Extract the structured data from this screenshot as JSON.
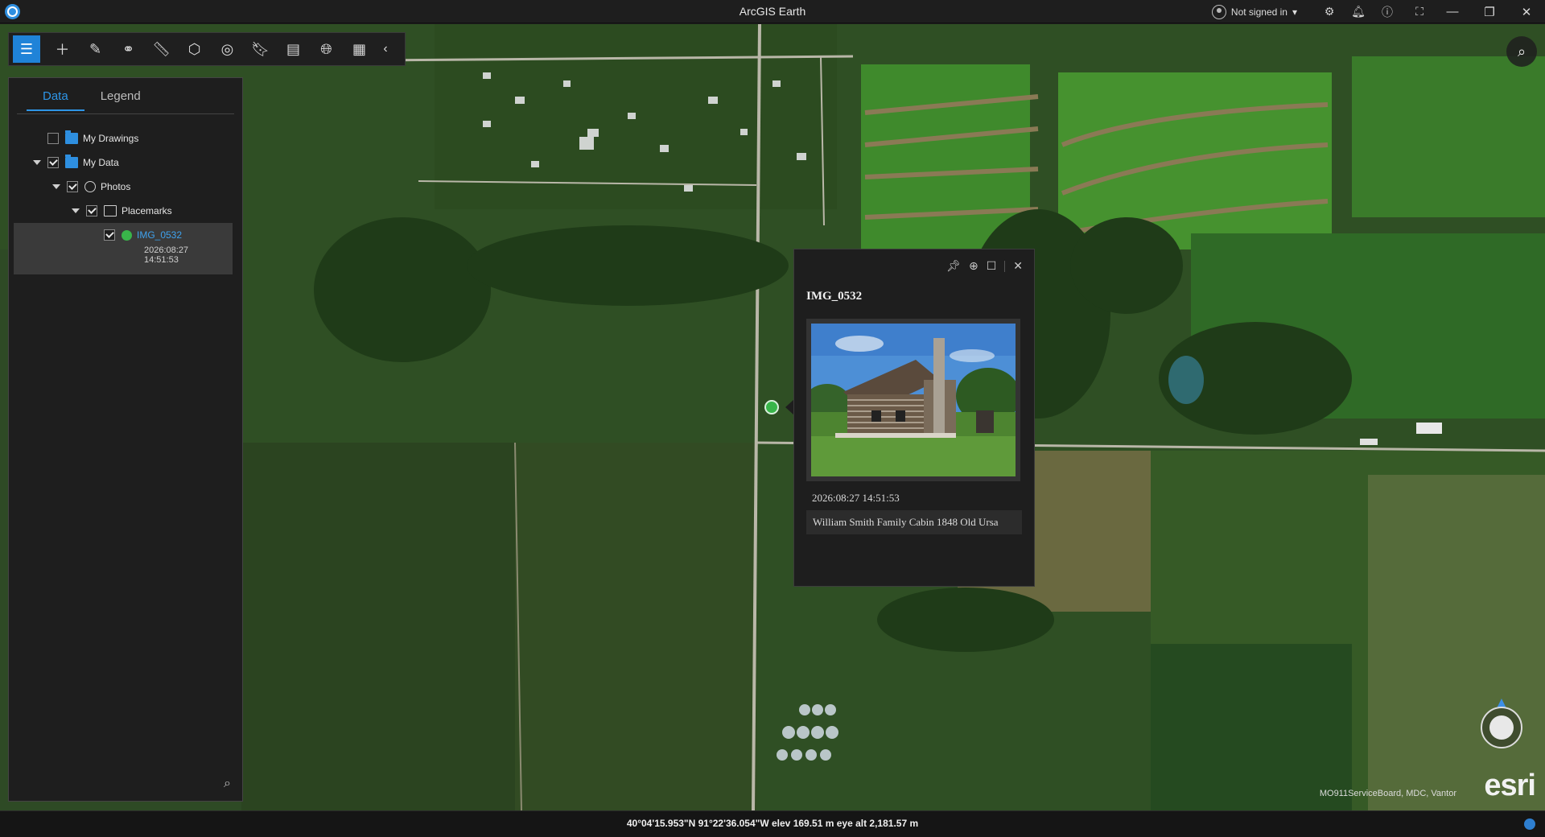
{
  "window": {
    "title": "ArcGIS Earth",
    "user": "Not signed in",
    "user_caret": "▾"
  },
  "icons": {
    "settings": "gear-icon",
    "notifications": "bell-icon",
    "about": "info-icon",
    "fullscreen": "fullscreen-icon",
    "minimize": "minimize-icon",
    "restore": "restore-icon",
    "close": "close-icon"
  },
  "toolbar": {
    "tools": [
      "layers",
      "add",
      "draw",
      "measure-link",
      "measure",
      "3d",
      "overlay",
      "bookmark",
      "presentation",
      "globe",
      "grid"
    ]
  },
  "panel": {
    "tabs": [
      "Data",
      "Legend"
    ],
    "tree": {
      "my_drawings": "My Drawings",
      "my_data": "My Data",
      "photos": "Photos",
      "placemarks": "Placemarks",
      "photo_name": "IMG_0532",
      "photo_date": "2026:08:27",
      "photo_time": "14:51:53"
    }
  },
  "popup": {
    "title": "IMG_0532",
    "timestamp": "2026:08:27 14:51:53",
    "description": "William Smith Family Cabin 1848 Old Ursa"
  },
  "map": {
    "attribution": "MO911ServiceBoard, MDC, Vantor",
    "logo": "esri"
  },
  "status": {
    "coordinates": "40°04'15.953\"N 91°22'36.054\"W  elev 169.51 m   eye alt 2,181.57 m"
  },
  "colors": {
    "accent": "#1f83d8",
    "panel_bg": "#1e1e1e",
    "photo_marker": "#39b54a"
  }
}
